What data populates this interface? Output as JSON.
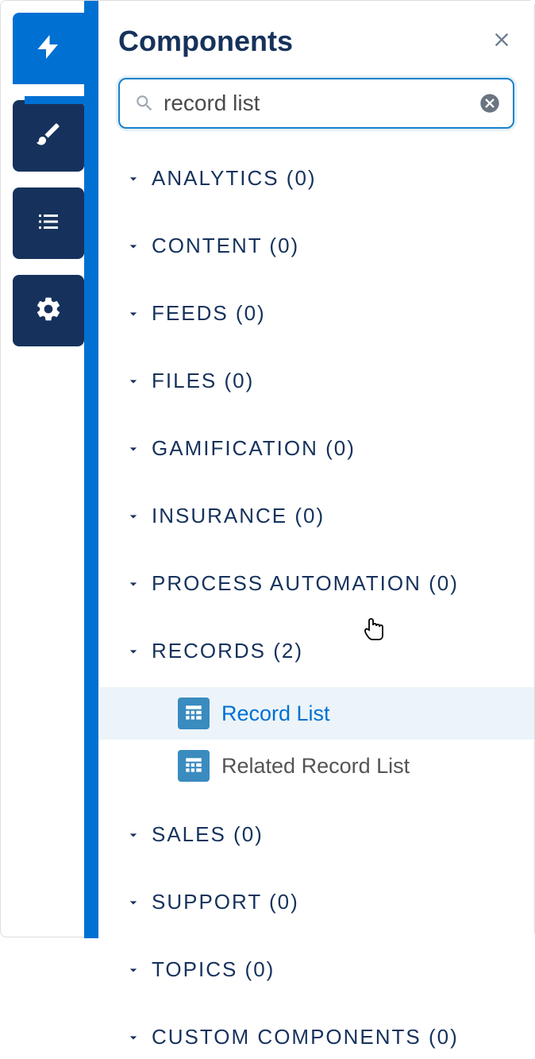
{
  "panel": {
    "title": "Components"
  },
  "search": {
    "value": "record list"
  },
  "categories": [
    {
      "label": "ANALYTICS",
      "count": 0
    },
    {
      "label": "CONTENT",
      "count": 0
    },
    {
      "label": "FEEDS",
      "count": 0
    },
    {
      "label": "FILES",
      "count": 0
    },
    {
      "label": "GAMIFICATION",
      "count": 0
    },
    {
      "label": "INSURANCE",
      "count": 0
    },
    {
      "label": "PROCESS AUTOMATION",
      "count": 0
    },
    {
      "label": "RECORDS",
      "count": 2,
      "items": [
        {
          "label": "Record List",
          "hovered": true
        },
        {
          "label": "Related Record List",
          "hovered": false
        }
      ]
    },
    {
      "label": "SALES",
      "count": 0
    },
    {
      "label": "SUPPORT",
      "count": 0
    },
    {
      "label": "TOPICS",
      "count": 0
    },
    {
      "label": "CUSTOM COMPONENTS",
      "count": 0
    }
  ]
}
